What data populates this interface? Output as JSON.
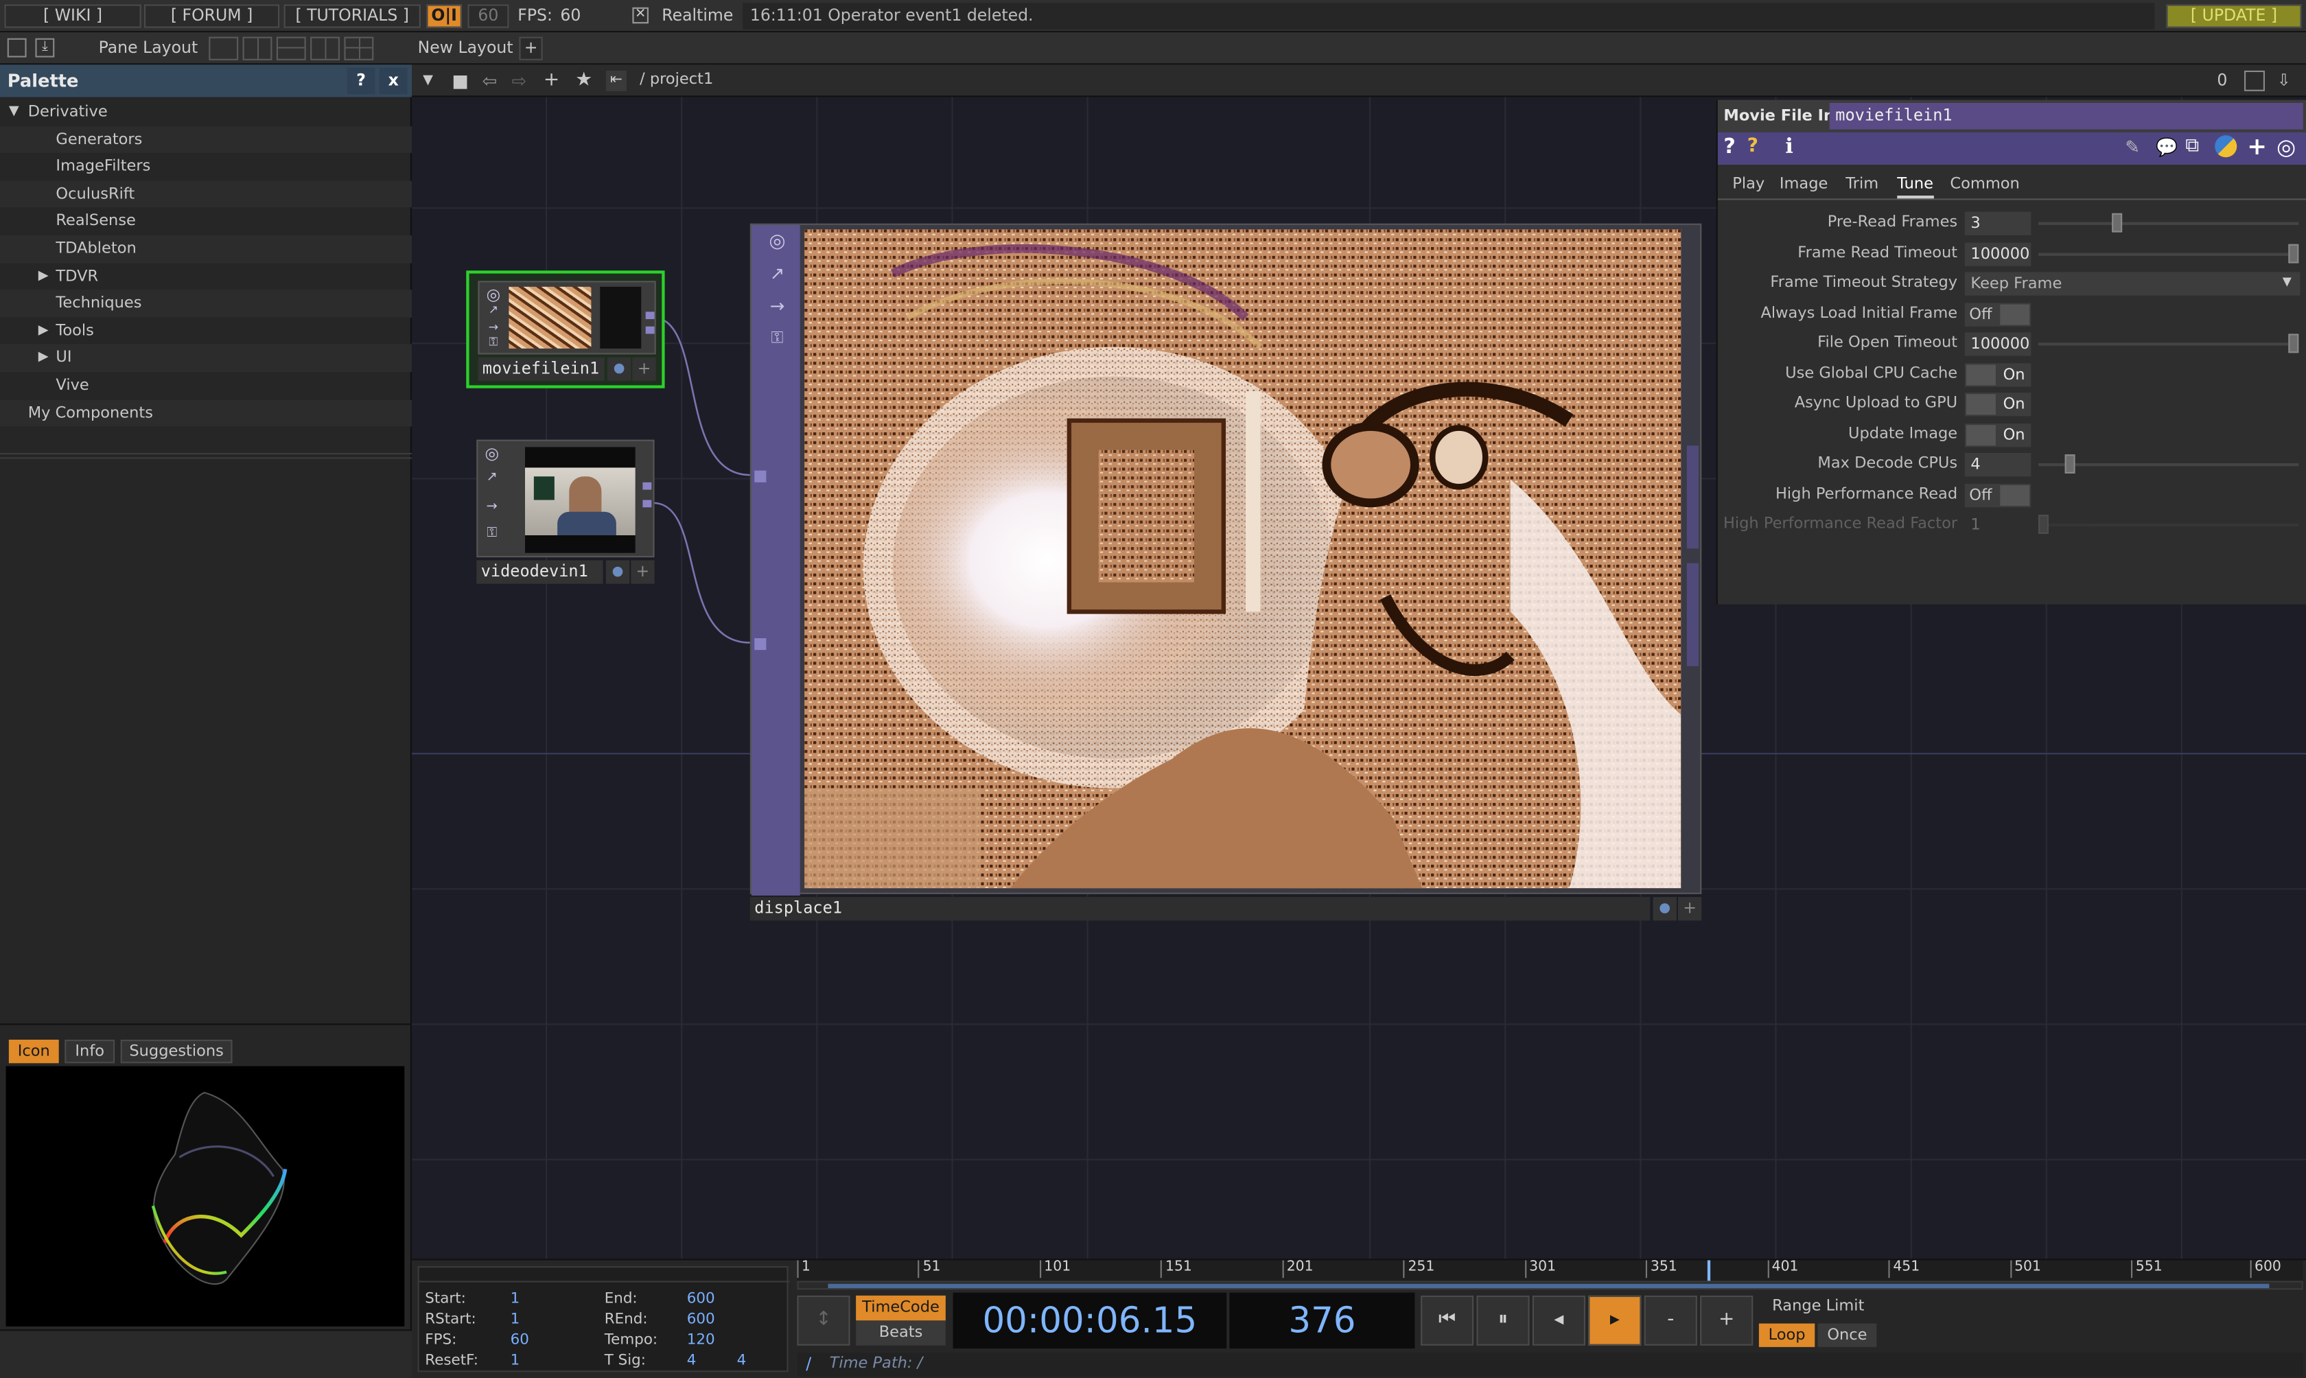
{
  "top_bar": {
    "wiki": "[ WIKI ]",
    "forum": "[ FORUM ]",
    "tutorials": "[ TUTORIALS ]",
    "oi": "O|I",
    "fps_cap": "60",
    "fps_label": "FPS:",
    "fps_value": "60",
    "realtime_label": "Realtime",
    "realtime_checked": true,
    "status_message": "16:11:01 Operator event1 deleted.",
    "update": "[ UPDATE ]"
  },
  "toolbar2": {
    "pane_layout": "Pane Layout",
    "new_layout": "New Layout",
    "add": "+"
  },
  "net_toolbar": {
    "path": "/ project1",
    "right_value": "0"
  },
  "palette": {
    "title": "Palette",
    "help": "?",
    "close": "x",
    "items": [
      {
        "label": "Derivative",
        "level": 0,
        "arrow": "down"
      },
      {
        "label": "Generators",
        "level": 1,
        "arrow": ""
      },
      {
        "label": "ImageFilters",
        "level": 1,
        "arrow": ""
      },
      {
        "label": "OculusRift",
        "level": 1,
        "arrow": ""
      },
      {
        "label": "RealSense",
        "level": 1,
        "arrow": ""
      },
      {
        "label": "TDAbleton",
        "level": 1,
        "arrow": ""
      },
      {
        "label": "TDVR",
        "level": 1,
        "arrow": "right"
      },
      {
        "label": "Techniques",
        "level": 1,
        "arrow": ""
      },
      {
        "label": "Tools",
        "level": 1,
        "arrow": "right"
      },
      {
        "label": "UI",
        "level": 1,
        "arrow": "right"
      },
      {
        "label": "Vive",
        "level": 1,
        "arrow": ""
      },
      {
        "label": "My Components",
        "level": 0,
        "arrow": ""
      }
    ],
    "bottom_tabs": [
      "Icon",
      "Info",
      "Suggestions"
    ],
    "active_bottom_tab": "Icon"
  },
  "nodes": {
    "moviefilein": "moviefilein1",
    "videodevin": "videodevin1",
    "displace": "displace1"
  },
  "params": {
    "op_type": "Movie File In",
    "op_name": "moviefilein1",
    "tabs": [
      "Play",
      "Image",
      "Trim",
      "Tune",
      "Common"
    ],
    "active_tab": "Tune",
    "rows": [
      {
        "label": "Pre-Read Frames",
        "kind": "slider",
        "value": "3",
        "pos": 0.32
      },
      {
        "label": "Frame Read Timeout",
        "kind": "slider",
        "value": "100000",
        "pos": 1.0
      },
      {
        "label": "Frame Timeout Strategy",
        "kind": "menu",
        "value": "Keep Frame"
      },
      {
        "label": "Always Load Initial Frame",
        "kind": "toggle",
        "value": "Off",
        "on": false
      },
      {
        "label": "File Open Timeout",
        "kind": "slider",
        "value": "100000",
        "pos": 1.0
      },
      {
        "label": "Use Global CPU Cache",
        "kind": "toggle",
        "value": "On",
        "on": true
      },
      {
        "label": "Async Upload to GPU",
        "kind": "toggle",
        "value": "On",
        "on": true
      },
      {
        "label": "Update Image",
        "kind": "toggle",
        "value": "On",
        "on": true
      },
      {
        "label": "Max Decode CPUs",
        "kind": "slider",
        "value": "4",
        "pos": 0.12
      },
      {
        "label": "High Performance Read",
        "kind": "toggle",
        "value": "Off",
        "on": false
      },
      {
        "label": "High Performance Read Factor",
        "kind": "slider",
        "value": "1",
        "pos": 0.0,
        "disabled": true
      }
    ]
  },
  "timeline": {
    "ticks": [
      "1",
      "51",
      "101",
      "151",
      "201",
      "251",
      "301",
      "351",
      "401",
      "451",
      "501",
      "551",
      "600"
    ],
    "playhead_frame": 376,
    "frame_range": [
      1,
      600
    ],
    "info": [
      {
        "label": "Start:",
        "value": "1",
        "label2": "End:",
        "value2": "600"
      },
      {
        "label": "RStart:",
        "value": "1",
        "label2": "REnd:",
        "value2": "600"
      },
      {
        "label": "FPS:",
        "value": "60",
        "label2": "Tempo:",
        "value2": "120"
      },
      {
        "label": "ResetF:",
        "value": "1",
        "label2": "T Sig:",
        "value2": "4",
        "value3": "4"
      }
    ],
    "timecode_btn": "TimeCode",
    "beats_btn": "Beats",
    "timecode": "00:00:06.15",
    "frame": "376",
    "minus": "-",
    "plus": "+",
    "range_limit": "Range Limit",
    "loop": "Loop",
    "once": "Once",
    "time_path": "Time Path: /",
    "slash": "/"
  },
  "colors": {
    "accent": "#e08a29",
    "selected_node": "#2bd12b",
    "param_header": "#5a4a86",
    "palette_header": "#34495c"
  }
}
